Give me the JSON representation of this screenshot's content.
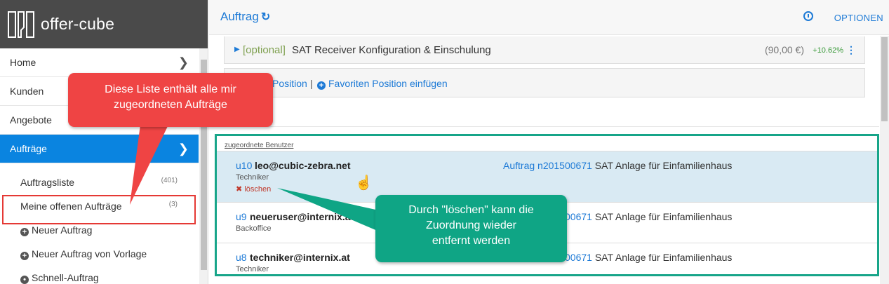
{
  "brand": {
    "name": "offer-cube"
  },
  "sidebar": {
    "items": [
      {
        "label": "Home"
      },
      {
        "label": "Kunden"
      },
      {
        "label": "Angebote"
      },
      {
        "label": "Aufträge"
      }
    ],
    "sub_items": [
      {
        "label": "Auftragsliste",
        "count": "(401)"
      },
      {
        "label": "Meine offenen Aufträge",
        "count": "(3)"
      },
      {
        "label": "Neuer Auftrag"
      },
      {
        "label": "Neuer Auftrag von Vorlage"
      },
      {
        "label": "Schnell-Auftrag"
      }
    ]
  },
  "header": {
    "title": "Auftrag",
    "options_label": "OPTIONEN"
  },
  "position": {
    "optional_tag": "[optional]",
    "name": "SAT Receiver Konfiguration & Einschulung",
    "price": "(90,00 €)",
    "percent": "+10.62%"
  },
  "actions": {
    "add_position_visible": "Position",
    "separator": "|",
    "favorite": "Favoriten Position einfügen"
  },
  "users": {
    "heading": "zugeordnete Benutzer",
    "rows": [
      {
        "uid": "u10",
        "email": "leo@cubic-zebra.net",
        "role": "Techniker",
        "delete": "löschen",
        "auftrag_label": "Auftrag",
        "auftrag_number": "n201500671",
        "auftrag_desc": "SAT Anlage für Einfamilienhaus"
      },
      {
        "uid": "u9",
        "email": "neueruser@internix.at",
        "role": "Backoffice",
        "auftrag_number_partial": "00671",
        "auftrag_desc": "SAT Anlage für Einfamilienhaus"
      },
      {
        "uid": "u8",
        "email": "techniker@internix.at",
        "role": "Techniker",
        "auftrag_number_partial": "00671",
        "auftrag_desc": "SAT Anlage für Einfamilienhaus"
      }
    ]
  },
  "callouts": {
    "red": [
      "Diese Liste enthält alle mir",
      "zugeordneten Aufträge"
    ],
    "green": [
      "Durch \"löschen\" kann die",
      "Zuordnung wieder",
      "entfernt werden"
    ]
  },
  "colors": {
    "accent": "#1d7ad6",
    "active_nav": "#0a84e0",
    "callout_red": "#ef4444",
    "callout_green": "#0fa585"
  }
}
